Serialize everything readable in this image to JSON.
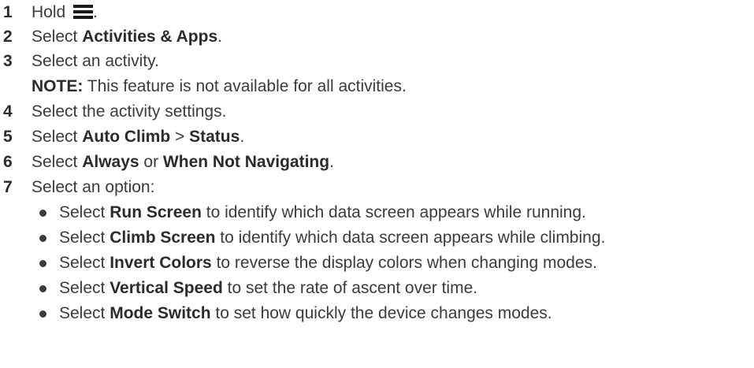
{
  "steps": [
    {
      "num": "1",
      "pre": "Hold ",
      "icon": "menu-icon",
      "post": "."
    },
    {
      "num": "2",
      "pre": "Select ",
      "bold": "Activities & Apps",
      "post": "."
    },
    {
      "num": "3",
      "pre": "Select an activity.",
      "note_label": "NOTE:",
      "note_text": " This feature is not available for all activities."
    },
    {
      "num": "4",
      "pre": "Select the activity settings."
    },
    {
      "num": "5",
      "pre": "Select ",
      "bold": "Auto Climb",
      "mid": " > ",
      "bold2": "Status",
      "post": "."
    },
    {
      "num": "6",
      "pre": "Select ",
      "bold": "Always",
      "mid": " or ",
      "bold2": "When Not Navigating",
      "post": "."
    },
    {
      "num": "7",
      "pre": "Select an option:"
    }
  ],
  "options": [
    {
      "pre": "Select ",
      "bold": "Run Screen",
      "post": " to identify which data screen appears while running."
    },
    {
      "pre": "Select ",
      "bold": "Climb Screen",
      "post": " to identify which data screen appears while climbing."
    },
    {
      "pre": "Select ",
      "bold": "Invert Colors",
      "post": " to reverse the display colors when changing modes."
    },
    {
      "pre": "Select ",
      "bold": "Vertical Speed",
      "post": " to set the rate of ascent over time."
    },
    {
      "pre": "Select ",
      "bold": "Mode Switch",
      "post": " to set how quickly the device changes modes."
    }
  ]
}
